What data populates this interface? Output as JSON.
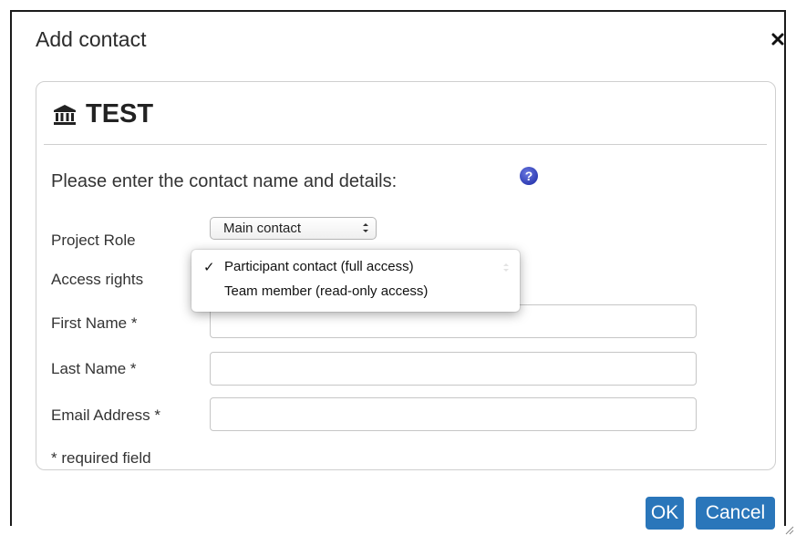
{
  "dialog": {
    "title": "Add contact"
  },
  "panel": {
    "title": "TEST",
    "intro": "Please enter the contact name and details:"
  },
  "form": {
    "project_role": {
      "label": "Project Role",
      "value": "Main contact"
    },
    "access_rights": {
      "label": "Access rights",
      "options": [
        {
          "label": "Participant contact (full access)",
          "selected": true
        },
        {
          "label": "Team member (read-only access)",
          "selected": false
        }
      ],
      "check_mark": "✓"
    },
    "first_name": {
      "label": "First Name *",
      "value": ""
    },
    "last_name": {
      "label": "Last Name *",
      "value": ""
    },
    "email": {
      "label": "Email Address *",
      "value": ""
    },
    "required_note": "* required field"
  },
  "buttons": {
    "ok": "OK",
    "cancel": "Cancel"
  },
  "icons": {
    "close": "close-icon",
    "institution": "bank-icon",
    "help": "help-icon"
  },
  "colors": {
    "accent": "#2a76ba",
    "help_icon": "#2e3cb3"
  }
}
